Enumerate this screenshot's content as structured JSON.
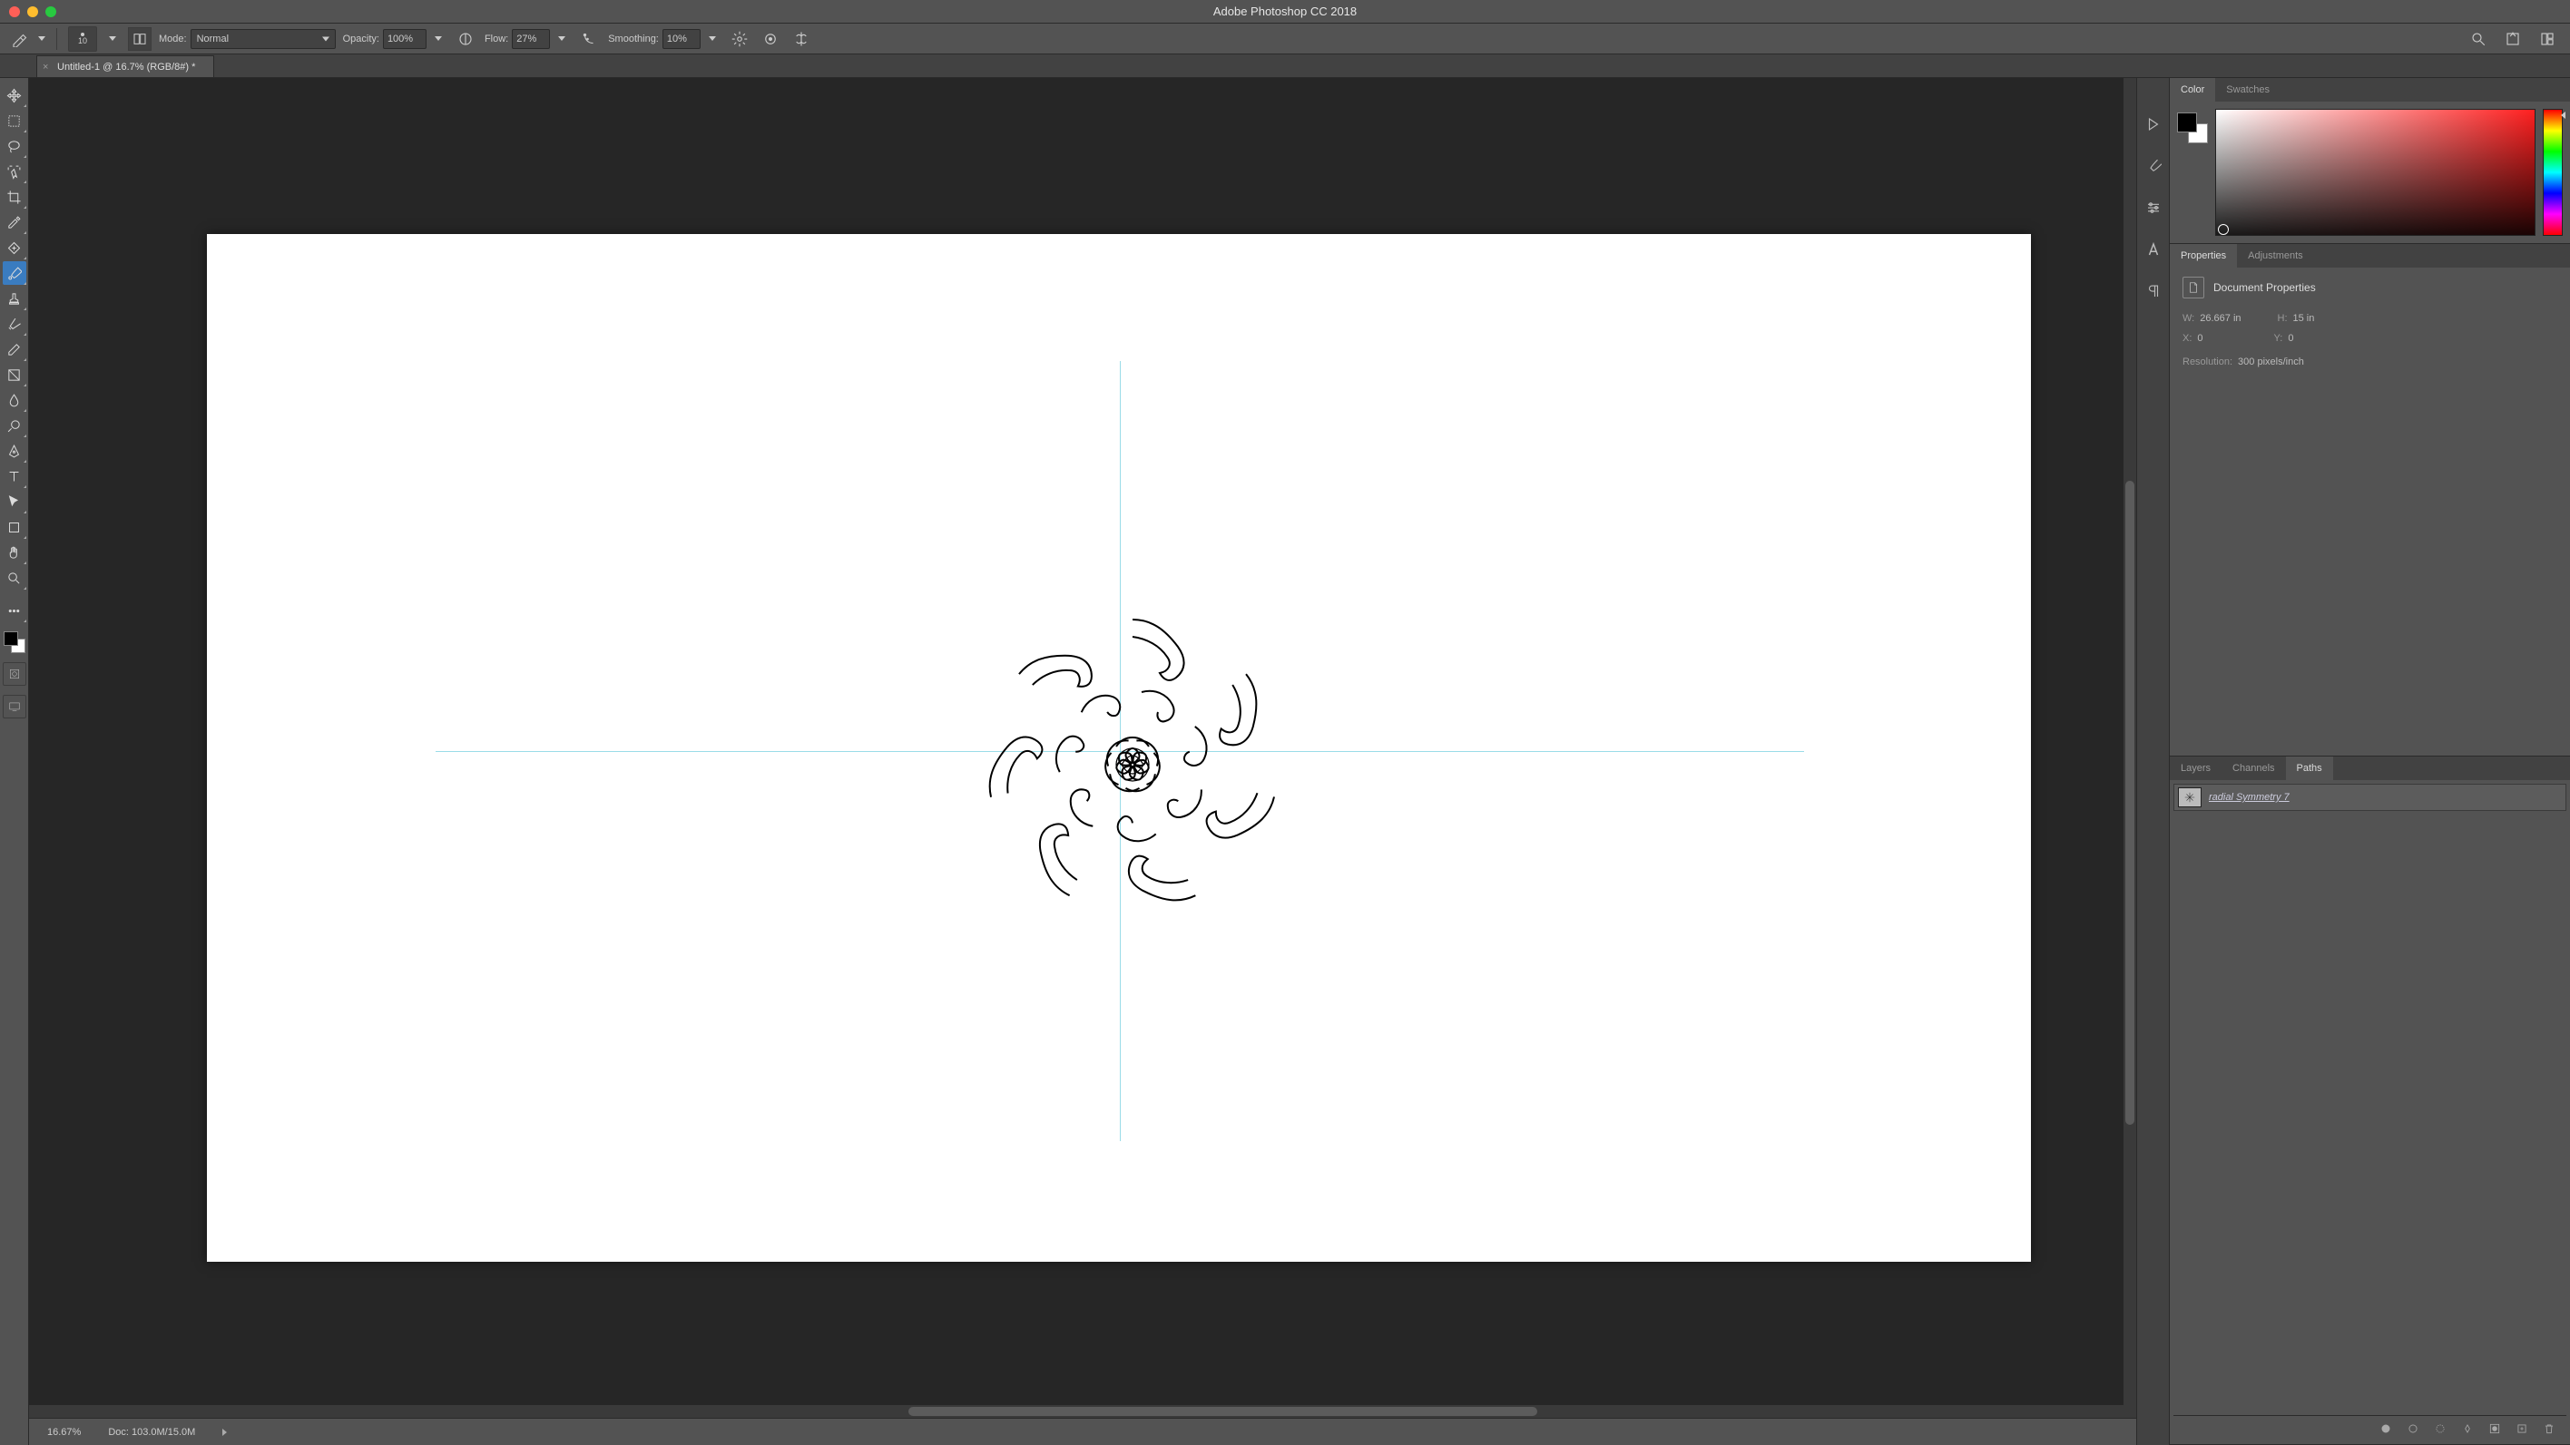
{
  "app": {
    "title": "Adobe Photoshop CC 2018"
  },
  "document": {
    "tab_title": "Untitled-1 @ 16.7% (RGB/8#) *"
  },
  "optionsBar": {
    "brush_size": "10",
    "mode_label": "Mode:",
    "mode_value": "Normal",
    "opacity_label": "Opacity:",
    "opacity_value": "100%",
    "flow_label": "Flow:",
    "flow_value": "27%",
    "smoothing_label": "Smoothing:",
    "smoothing_value": "10%"
  },
  "panels": {
    "color_tab": "Color",
    "swatches_tab": "Swatches",
    "properties_tab": "Properties",
    "adjustments_tab": "Adjustments",
    "layers_tab": "Layers",
    "channels_tab": "Channels",
    "paths_tab": "Paths"
  },
  "properties": {
    "title": "Document Properties",
    "w_label": "W:",
    "w_value": "26.667 in",
    "h_label": "H:",
    "h_value": "15 in",
    "x_label": "X:",
    "x_value": "0",
    "y_label": "Y:",
    "y_value": "0",
    "resolution_label": "Resolution:",
    "resolution_value": "300 pixels/inch"
  },
  "paths": {
    "item_name": "radial Symmetry 7"
  },
  "status": {
    "zoom": "16.67%",
    "doc_size": "Doc: 103.0M/15.0M"
  }
}
